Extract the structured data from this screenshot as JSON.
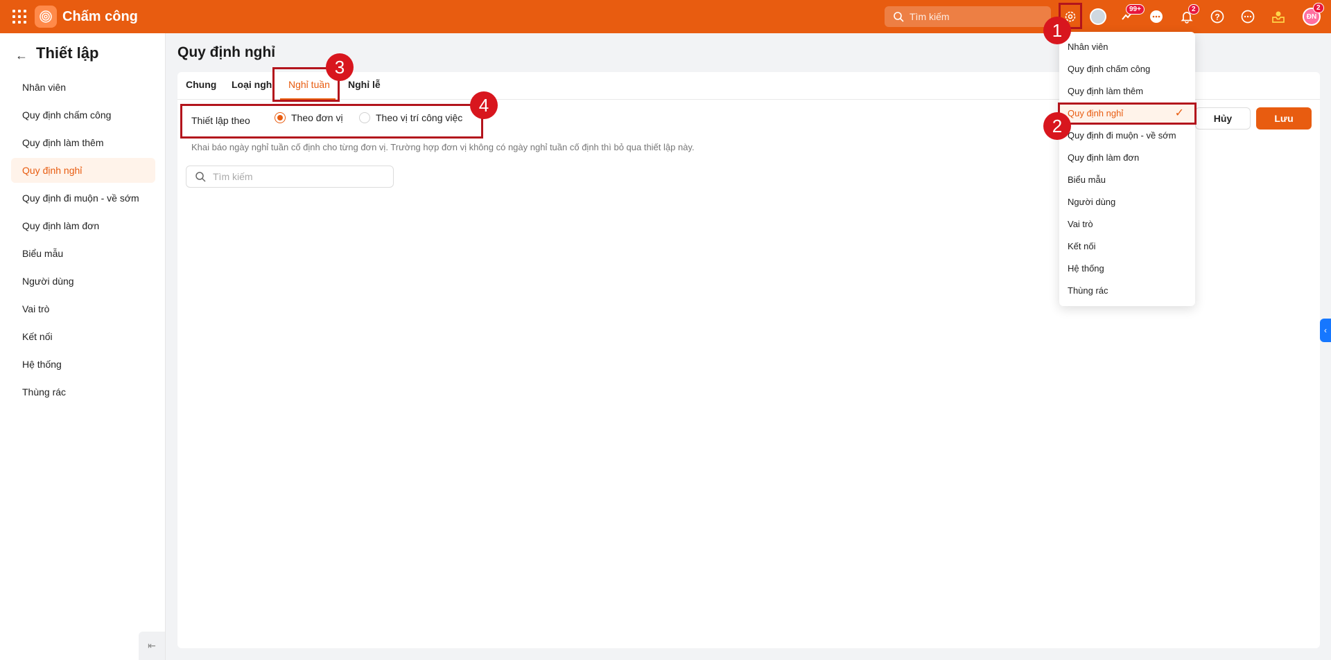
{
  "app": {
    "title": "Chấm công"
  },
  "topbar": {
    "search_placeholder": "Tìm kiếm",
    "badges": {
      "apps": "99+",
      "notifications": "2",
      "avatar": "2"
    },
    "avatar_initials": "ĐN"
  },
  "sidebar": {
    "title": "Thiết lập",
    "items": [
      {
        "label": "Nhân viên"
      },
      {
        "label": "Quy định chấm công"
      },
      {
        "label": "Quy định làm thêm"
      },
      {
        "label": "Quy định nghỉ",
        "active": true
      },
      {
        "label": "Quy định đi muộn - về sớm"
      },
      {
        "label": "Quy định làm đơn"
      },
      {
        "label": "Biểu mẫu"
      },
      {
        "label": "Người dùng"
      },
      {
        "label": "Vai trò"
      },
      {
        "label": "Kết nối"
      },
      {
        "label": "Hệ thống"
      },
      {
        "label": "Thùng rác"
      }
    ]
  },
  "main": {
    "page_title": "Quy định nghỉ",
    "tabs": [
      {
        "label": "Chung"
      },
      {
        "label": "Loại nghỉ"
      },
      {
        "label": "Nghỉ tuần",
        "active": true
      },
      {
        "label": "Nghỉ lễ"
      }
    ],
    "setting_label": "Thiết lập theo",
    "radio_options": [
      {
        "label": "Theo đơn vị",
        "selected": true
      },
      {
        "label": "Theo vị trí công việc",
        "selected": false
      }
    ],
    "description": "Khai báo ngày nghỉ tuần cố định cho từng đơn vị. Trường hợp đơn vị không có ngày nghỉ tuần cố định thì bỏ qua thiết lập này.",
    "search_placeholder": "Tìm kiếm",
    "cancel_label": "Hủy",
    "save_label": "Lưu"
  },
  "dropdown": {
    "items": [
      {
        "label": "Nhân viên"
      },
      {
        "label": "Quy định chấm công"
      },
      {
        "label": "Quy định làm thêm"
      },
      {
        "label": "Quy định nghỉ",
        "active": true
      },
      {
        "label": "Quy định đi muộn - về sớm"
      },
      {
        "label": "Quy định làm đơn"
      },
      {
        "label": "Biểu mẫu"
      },
      {
        "label": "Người dùng"
      },
      {
        "label": "Vai trò"
      },
      {
        "label": "Kết nối"
      },
      {
        "label": "Hệ thống"
      },
      {
        "label": "Thùng rác"
      }
    ]
  },
  "markers": {
    "m1": "1",
    "m2": "2",
    "m3": "3",
    "m4": "4"
  },
  "colors": {
    "brand": "#e85c10",
    "annotation": "#d8161e"
  }
}
